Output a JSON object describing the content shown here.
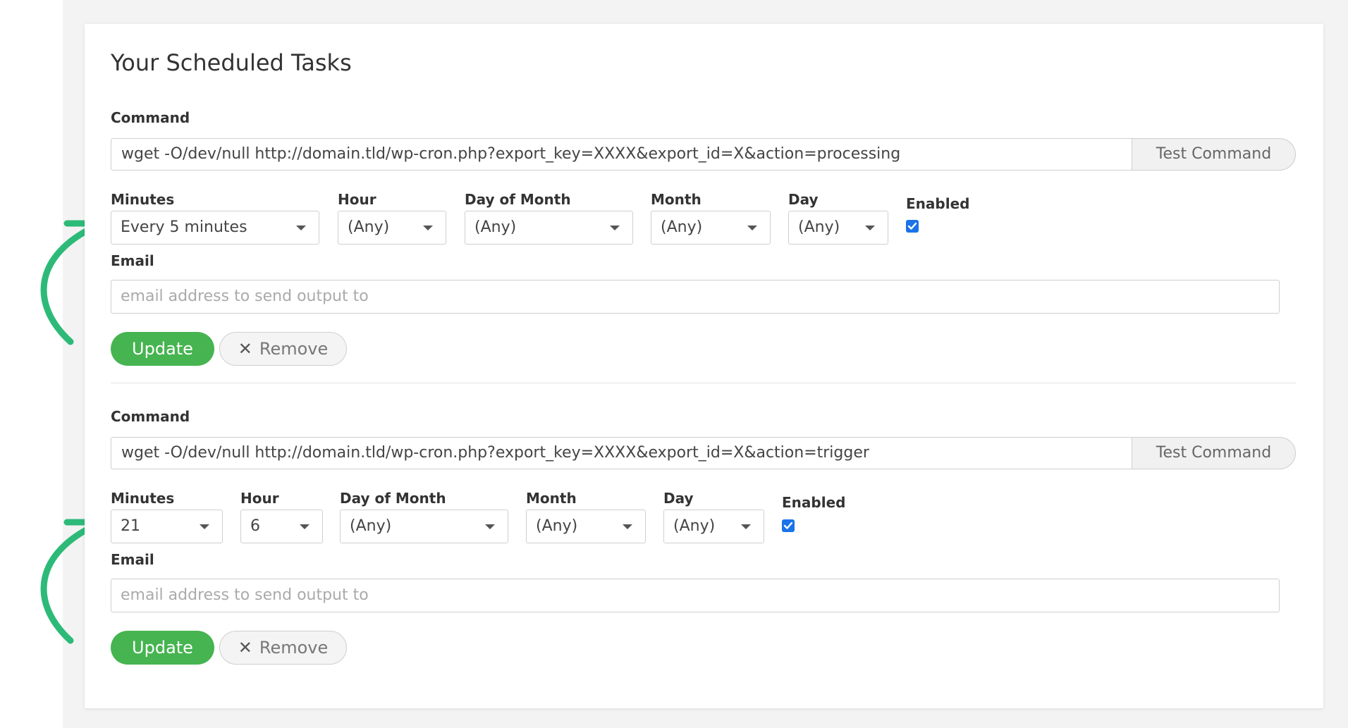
{
  "page": {
    "title": "Your Scheduled Tasks"
  },
  "labels": {
    "command": "Command",
    "minutes": "Minutes",
    "hour": "Hour",
    "day_of_month": "Day of Month",
    "month": "Month",
    "day": "Day",
    "enabled": "Enabled",
    "email": "Email"
  },
  "buttons": {
    "test_command": "Test Command",
    "update": "Update",
    "remove": "Remove"
  },
  "email_placeholder": "email address to send output to",
  "colors": {
    "update_green": "#46b450",
    "arrow_green": "#2dba78",
    "checkbox_blue": "#1a73e8"
  },
  "tasks": [
    {
      "command": "wget -O/dev/null http://domain.tld/wp-cron.php?export_key=XXXX&export_id=X&action=processing",
      "minutes": "Every 5 minutes",
      "hour": "(Any)",
      "day_of_month": "(Any)",
      "month": "(Any)",
      "day": "(Any)",
      "enabled": true,
      "email": ""
    },
    {
      "command": "wget -O/dev/null http://domain.tld/wp-cron.php?export_key=XXXX&export_id=X&action=trigger",
      "minutes": "21",
      "hour": "6",
      "day_of_month": "(Any)",
      "month": "(Any)",
      "day": "(Any)",
      "enabled": true,
      "email": ""
    }
  ]
}
